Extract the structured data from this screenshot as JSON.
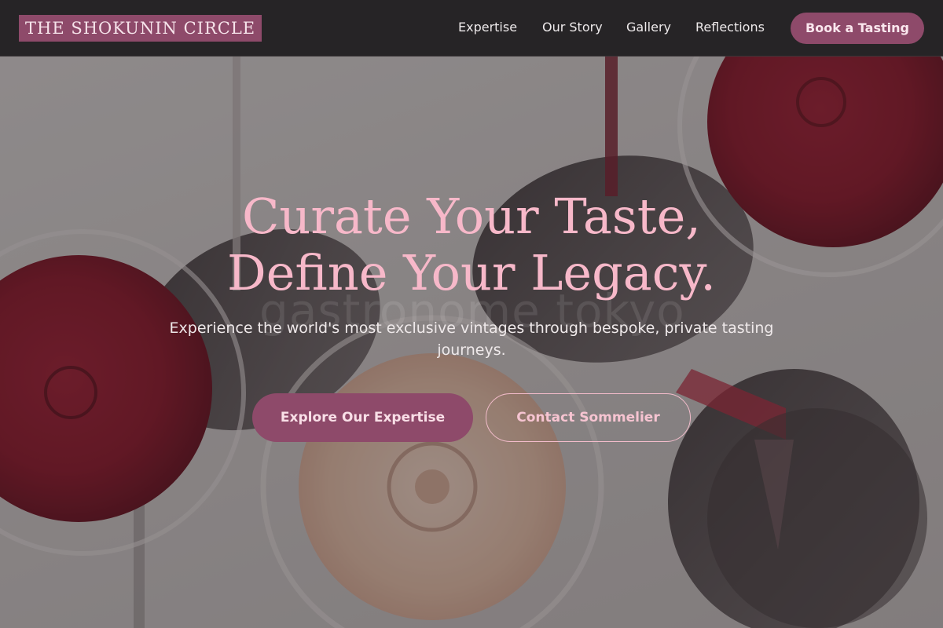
{
  "brand": {
    "logo_text": "THE SHOKUNIN CIRCLE",
    "accent_color": "#8e4a6a",
    "title_color": "#f7b8c9"
  },
  "nav": {
    "items": [
      {
        "label": "Expertise"
      },
      {
        "label": "Our Story"
      },
      {
        "label": "Gallery"
      },
      {
        "label": "Reflections"
      }
    ],
    "cta_label": "Book a Tasting"
  },
  "hero": {
    "title_line1": "Curate Your Taste,",
    "title_line2": "Define Your Legacy.",
    "subtitle": "Experience the world's most exclusive vintages through bespoke, private tasting journeys.",
    "watermark": "gastronome tokyo",
    "primary_cta": "Explore Our Expertise",
    "secondary_cta": "Contact Sommelier",
    "background_image": "wine-glasses-photo"
  }
}
